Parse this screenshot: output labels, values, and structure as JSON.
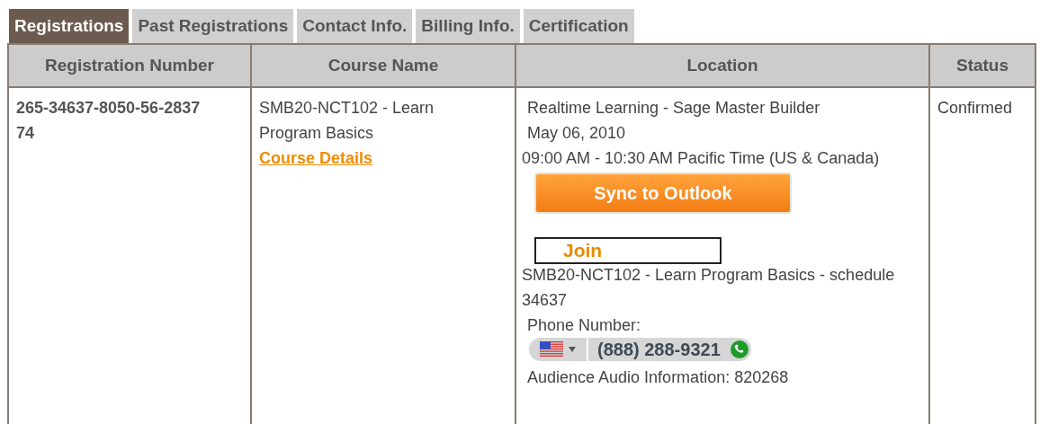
{
  "tabs": [
    {
      "label": "Registrations",
      "selected": true
    },
    {
      "label": "Past Registrations",
      "selected": false
    },
    {
      "label": "Contact Info.",
      "selected": false
    },
    {
      "label": "Billing Info.",
      "selected": false
    },
    {
      "label": "Certification",
      "selected": false
    }
  ],
  "table": {
    "columns": [
      "Registration Number",
      "Course Name",
      "Location",
      "Status"
    ],
    "rows": [
      {
        "registration_number": "265-34637-8050-56-283774",
        "course_name": "SMB20-NCT102 - Learn Program Basics",
        "course_link": "Course Details",
        "location": {
          "venue": "Realtime Learning - Sage Master Builder",
          "date": "May 06, 2010",
          "time": "09:00 AM - 10:30 AM Pacific Time (US & Canada)",
          "sync_button": "Sync to Outlook",
          "join_button": "Join",
          "session": "SMB20-NCT102 - Learn Program Basics - schedule 34637",
          "phone_label": "Phone Number:",
          "phone": "(888) 288-9321",
          "audio": "Audience Audio Information: 820268"
        },
        "status": "Confirmed"
      }
    ]
  }
}
